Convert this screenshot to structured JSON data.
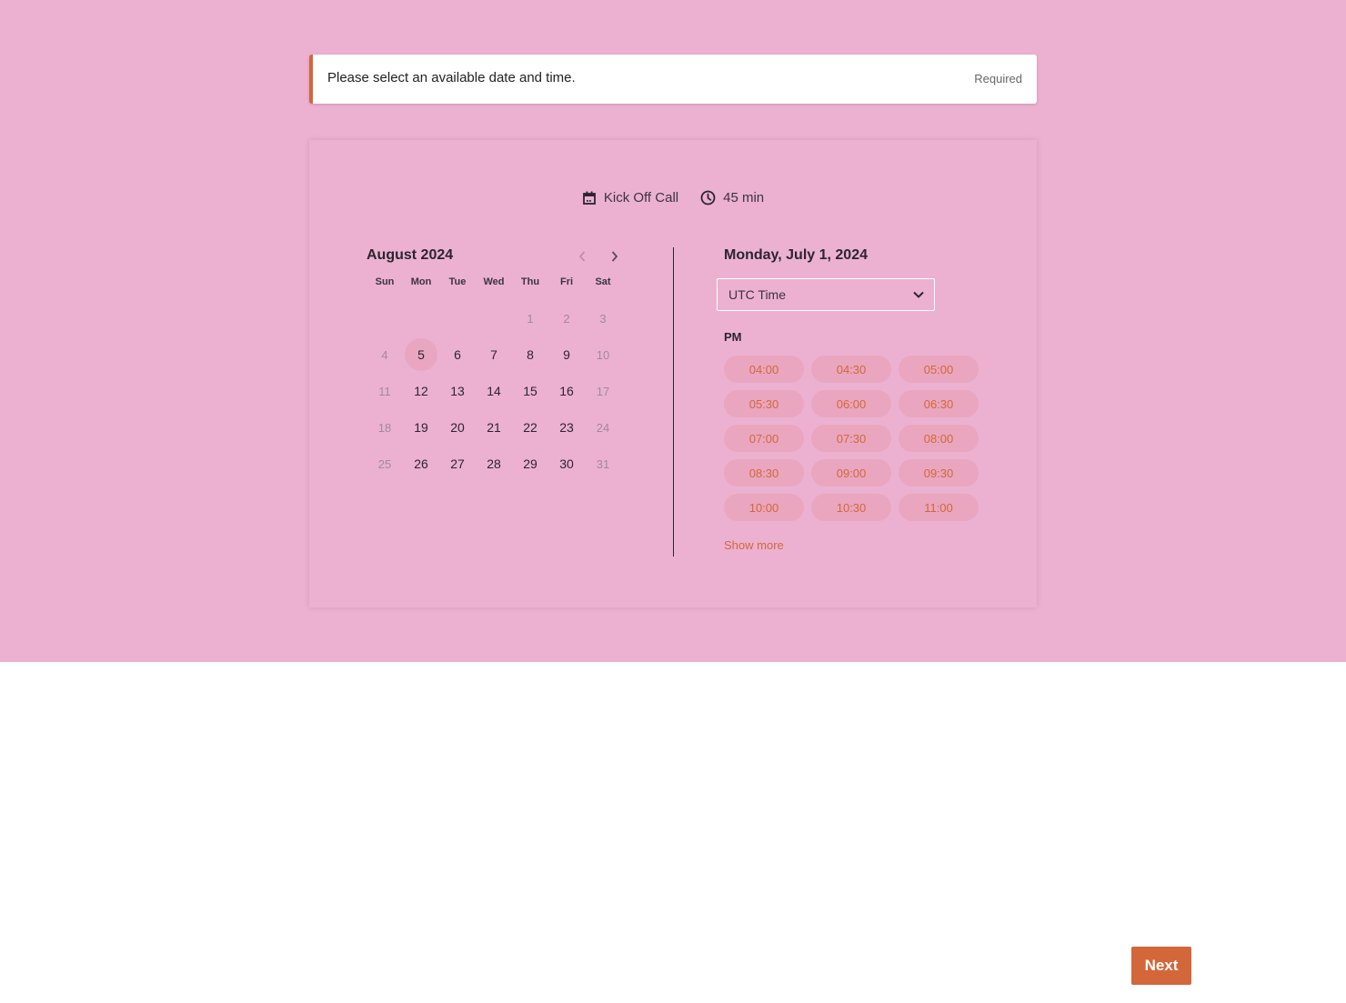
{
  "alert": {
    "message": "Please select an available date and time.",
    "required_label": "Required"
  },
  "event": {
    "title": "Kick Off Call",
    "title_icon": "calendar-icon",
    "duration": "45 min",
    "duration_icon": "clock-icon"
  },
  "calendar": {
    "month_label": "August 2024",
    "prev_icon": "chevron-left-icon",
    "next_icon": "chevron-right-icon",
    "weekdays": [
      "Sun",
      "Mon",
      "Tue",
      "Wed",
      "Thu",
      "Fri",
      "Sat"
    ],
    "selected_day": "5",
    "weeks": [
      [
        {
          "d": "",
          "s": "empty"
        },
        {
          "d": "",
          "s": "empty"
        },
        {
          "d": "",
          "s": "empty"
        },
        {
          "d": "",
          "s": "empty"
        },
        {
          "d": "1",
          "s": "muted"
        },
        {
          "d": "2",
          "s": "muted"
        },
        {
          "d": "3",
          "s": "muted"
        }
      ],
      [
        {
          "d": "4",
          "s": "muted"
        },
        {
          "d": "5",
          "s": "selected"
        },
        {
          "d": "6",
          "s": "available"
        },
        {
          "d": "7",
          "s": "available"
        },
        {
          "d": "8",
          "s": "available"
        },
        {
          "d": "9",
          "s": "available"
        },
        {
          "d": "10",
          "s": "muted"
        }
      ],
      [
        {
          "d": "11",
          "s": "muted"
        },
        {
          "d": "12",
          "s": "available"
        },
        {
          "d": "13",
          "s": "available"
        },
        {
          "d": "14",
          "s": "available"
        },
        {
          "d": "15",
          "s": "available"
        },
        {
          "d": "16",
          "s": "available"
        },
        {
          "d": "17",
          "s": "muted"
        }
      ],
      [
        {
          "d": "18",
          "s": "muted"
        },
        {
          "d": "19",
          "s": "available"
        },
        {
          "d": "20",
          "s": "available"
        },
        {
          "d": "21",
          "s": "available"
        },
        {
          "d": "22",
          "s": "available"
        },
        {
          "d": "23",
          "s": "available"
        },
        {
          "d": "24",
          "s": "muted"
        }
      ],
      [
        {
          "d": "25",
          "s": "muted"
        },
        {
          "d": "26",
          "s": "available"
        },
        {
          "d": "27",
          "s": "available"
        },
        {
          "d": "28",
          "s": "available"
        },
        {
          "d": "29",
          "s": "available"
        },
        {
          "d": "30",
          "s": "available"
        },
        {
          "d": "31",
          "s": "muted"
        }
      ]
    ]
  },
  "times": {
    "date_label": "Monday, July 1, 2024",
    "timezone": "UTC Time",
    "timezone_icon": "chevron-down-icon",
    "period": "PM",
    "slots": [
      "04:00",
      "04:30",
      "05:00",
      "05:30",
      "06:00",
      "06:30",
      "07:00",
      "07:30",
      "08:00",
      "08:30",
      "09:00",
      "09:30",
      "10:00",
      "10:30",
      "11:00"
    ],
    "show_more": "Show more"
  },
  "footer": {
    "next_label": "Next"
  },
  "colors": {
    "background": "#ecb1d1",
    "accent": "#d3673a",
    "slot_bg": "#e9a6be",
    "text": "#2b2530"
  }
}
